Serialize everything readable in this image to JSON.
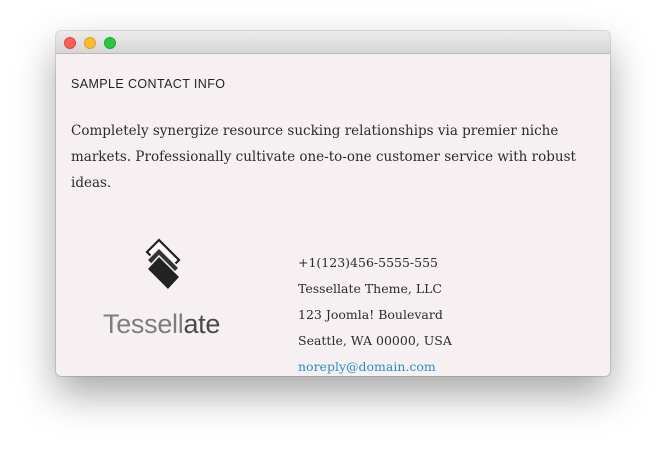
{
  "window": {
    "controls": [
      "close",
      "minimize",
      "zoom"
    ]
  },
  "section": {
    "heading": "SAMPLE CONTACT INFO",
    "description": "Completely synergize resource sucking relationships via premier niche markets. Professionally cultivate one-to-one customer service with robust ideas."
  },
  "logo": {
    "text_light": "Tessell",
    "text_dark": "ate",
    "icon": "stacked-diamonds-icon"
  },
  "contact": {
    "phone": "+1(123)456-5555-555",
    "company": "Tessellate Theme, LLC",
    "address_line1": "123 Joomla! Boulevard",
    "address_line2": "Seattle, WA 00000, USA",
    "email": "noreply@domain.com"
  },
  "colors": {
    "link": "#2a8fc0",
    "background": "#f6f0f3"
  }
}
